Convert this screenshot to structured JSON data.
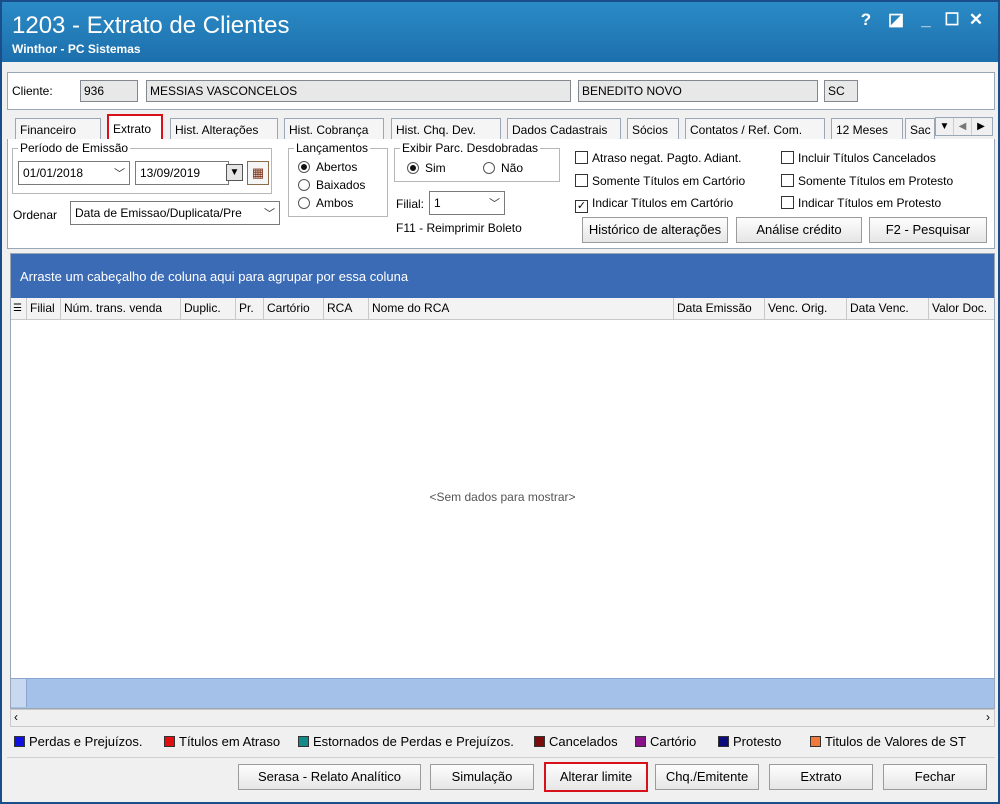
{
  "window": {
    "title": "1203 - Extrato de Clientes",
    "subtitle": "Winthor - PC Sistemas",
    "controls": [
      "?",
      "◪",
      "_",
      "☐",
      "✕"
    ]
  },
  "client": {
    "label": "Cliente:",
    "code": "936",
    "name": "MESSIAS VASCONCELOS",
    "city": "BENEDITO NOVO",
    "state": "SC"
  },
  "tabs": [
    {
      "label": "Financeiro",
      "active": false
    },
    {
      "label": "Extrato",
      "active": true
    },
    {
      "label": "Hist. Alterações",
      "active": false
    },
    {
      "label": "Hist. Cobrança",
      "active": false
    },
    {
      "label": "Hist. Chq. Dev.",
      "active": false
    },
    {
      "label": "Dados Cadastrais",
      "active": false
    },
    {
      "label": "Sócios",
      "active": false
    },
    {
      "label": "Contatos / Ref. Com.",
      "active": false
    },
    {
      "label": "12 Meses",
      "active": false
    },
    {
      "label": "Sac",
      "active": false
    }
  ],
  "filters": {
    "periodo_label": "Período de Emissão",
    "date_from": "01/01/2018",
    "date_to": "13/09/2019",
    "ordenar_label": "Ordenar",
    "ordenar_value": "Data de Emissao/Duplicata/Pre",
    "lancamentos_label": "Lançamentos",
    "lancamentos_options": [
      "Abertos",
      "Baixados",
      "Ambos"
    ],
    "lancamentos_selected": "Abertos",
    "exibir_label": "Exibir Parc. Desdobradas",
    "exibir_options": [
      "Sim",
      "Não"
    ],
    "exibir_selected": "Sim",
    "filial_label": "Filial:",
    "filial_value": "1",
    "reimprimir": "F11 - Reimprimir Boleto"
  },
  "checks": [
    {
      "label": "Atraso negat. Pagto. Adiant.",
      "checked": false
    },
    {
      "label": "Incluir Títulos Cancelados",
      "checked": false
    },
    {
      "label": "Somente Títulos em Cartório",
      "checked": false
    },
    {
      "label": "Somente Títulos em Protesto",
      "checked": false
    },
    {
      "label": "Indicar Títulos em Cartório",
      "checked": true
    },
    {
      "label": "Indicar Títulos em Protesto",
      "checked": false
    }
  ],
  "actions": {
    "historico": "Histórico de alterações",
    "analise": "Análise crédito",
    "pesquisar": "F2 - Pesquisar"
  },
  "grid": {
    "group_hint": "Arraste um cabeçalho de coluna aqui para agrupar por essa coluna",
    "columns": [
      "Filial",
      "Núm. trans. venda",
      "Duplic.",
      "Pr.",
      "Cartório",
      "RCA",
      "Nome do RCA",
      "Data Emissão",
      "Venc. Orig.",
      "Data Venc.",
      "Valor Doc."
    ],
    "empty_text": "<Sem dados para mostrar>"
  },
  "legend": [
    {
      "label": "Perdas e Prejuízos.",
      "color": "#1010e0"
    },
    {
      "label": "Títulos em Atraso",
      "color": "#e01010"
    },
    {
      "label": "Estornados de Perdas e Prejuízos.",
      "color": "#138a8a"
    },
    {
      "label": "Cancelados",
      "color": "#7a0c0c"
    },
    {
      "label": "Cartório",
      "color": "#8a108a"
    },
    {
      "label": "Protesto",
      "color": "#0c0c7a"
    },
    {
      "label": "Titulos de Valores de ST",
      "color": "#f07a3a"
    }
  ],
  "bottom_buttons": {
    "serasa": "Serasa - Relato Analítico",
    "simulacao": "Simulação",
    "alterar": "Alterar limite",
    "chq": "Chq./Emitente",
    "extrato": "Extrato",
    "fechar": "Fechar"
  }
}
